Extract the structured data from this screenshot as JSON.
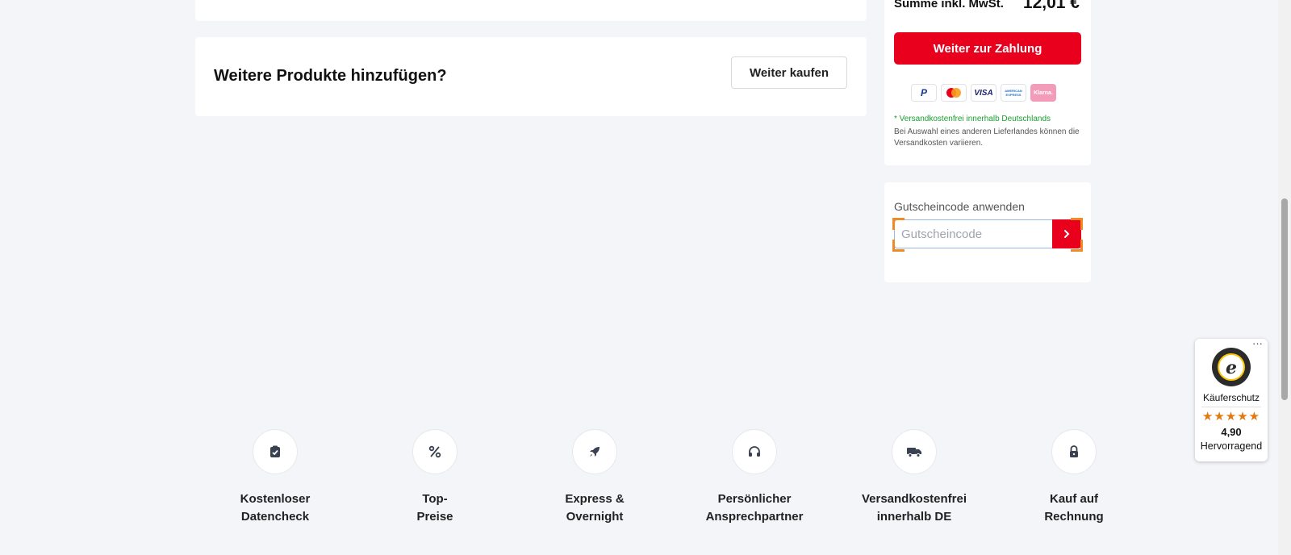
{
  "add_products": {
    "title": "Weitere Produkte hinzufügen?",
    "continue_button": "Weiter kaufen"
  },
  "summary": {
    "total_label": "Summe inkl. MwSt.",
    "total_value": "12,01 €",
    "pay_button": "Weiter zur Zahlung",
    "payment_methods": [
      "P",
      "Mastercard",
      "VISA",
      "AMERICAN EXPRESS",
      "Klarna."
    ],
    "shipping_note": "* Versandkostenfrei innerhalb Deutschlands",
    "shipping_sub": "Bei Auswahl eines anderen Lieferlandes können die Versandkosten variieren."
  },
  "coupon": {
    "label": "Gutscheincode anwenden",
    "placeholder": "Gutscheincode",
    "value": ""
  },
  "features": [
    {
      "icon": "clipboard-check-icon",
      "line1": "Kostenloser",
      "line2": "Datencheck"
    },
    {
      "icon": "percent-icon",
      "line1": "Top-",
      "line2": "Preise"
    },
    {
      "icon": "rocket-icon",
      "line1": "Express &",
      "line2": "Overnight"
    },
    {
      "icon": "headphones-icon",
      "line1": "Persönlicher",
      "line2": "Ansprechpartner"
    },
    {
      "icon": "truck-icon",
      "line1": "Versandkostenfrei",
      "line2": "innerhalb DE"
    },
    {
      "icon": "lock-icon",
      "line1": "Kauf auf",
      "line2": "Rechnung"
    }
  ],
  "trusted_shops": {
    "label": "Käuferschutz",
    "stars": "★★★★★",
    "score": "4,90",
    "rating": "Hervorragend",
    "menu": "···"
  },
  "colors": {
    "accent": "#e8001c",
    "background": "#f4f5f9",
    "success": "#1aa12e"
  }
}
